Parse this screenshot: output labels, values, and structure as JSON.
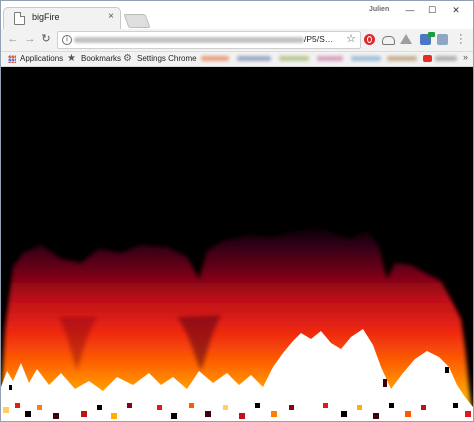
{
  "browser": {
    "user_name": "Julien",
    "window_controls": {
      "minimize": "—",
      "maximize": "☐",
      "close": "✕"
    }
  },
  "tabs": [
    {
      "title": "bigFire",
      "close_glyph": "×"
    }
  ],
  "toolbar": {
    "back_glyph": "←",
    "forward_glyph": "→",
    "reload_glyph": "↻",
    "url_visible_tail": "/P5/S…",
    "bookmark_star_glyph": "☆"
  },
  "bookmarks_bar": {
    "items": [
      {
        "label": "Applications",
        "icon": "apps-grid-icon"
      },
      {
        "label": "Bookmarks",
        "icon": "star-icon"
      },
      {
        "label": "Settings Chrome",
        "icon": "gear-icon"
      }
    ],
    "more_glyph": "»"
  },
  "page": {
    "sketch": "fire-simulation",
    "background": "#000000",
    "palette": [
      "#000000",
      "#3a0010",
      "#8a0018",
      "#e0181a",
      "#ff5a00",
      "#ffb000",
      "#ffffff"
    ]
  }
}
